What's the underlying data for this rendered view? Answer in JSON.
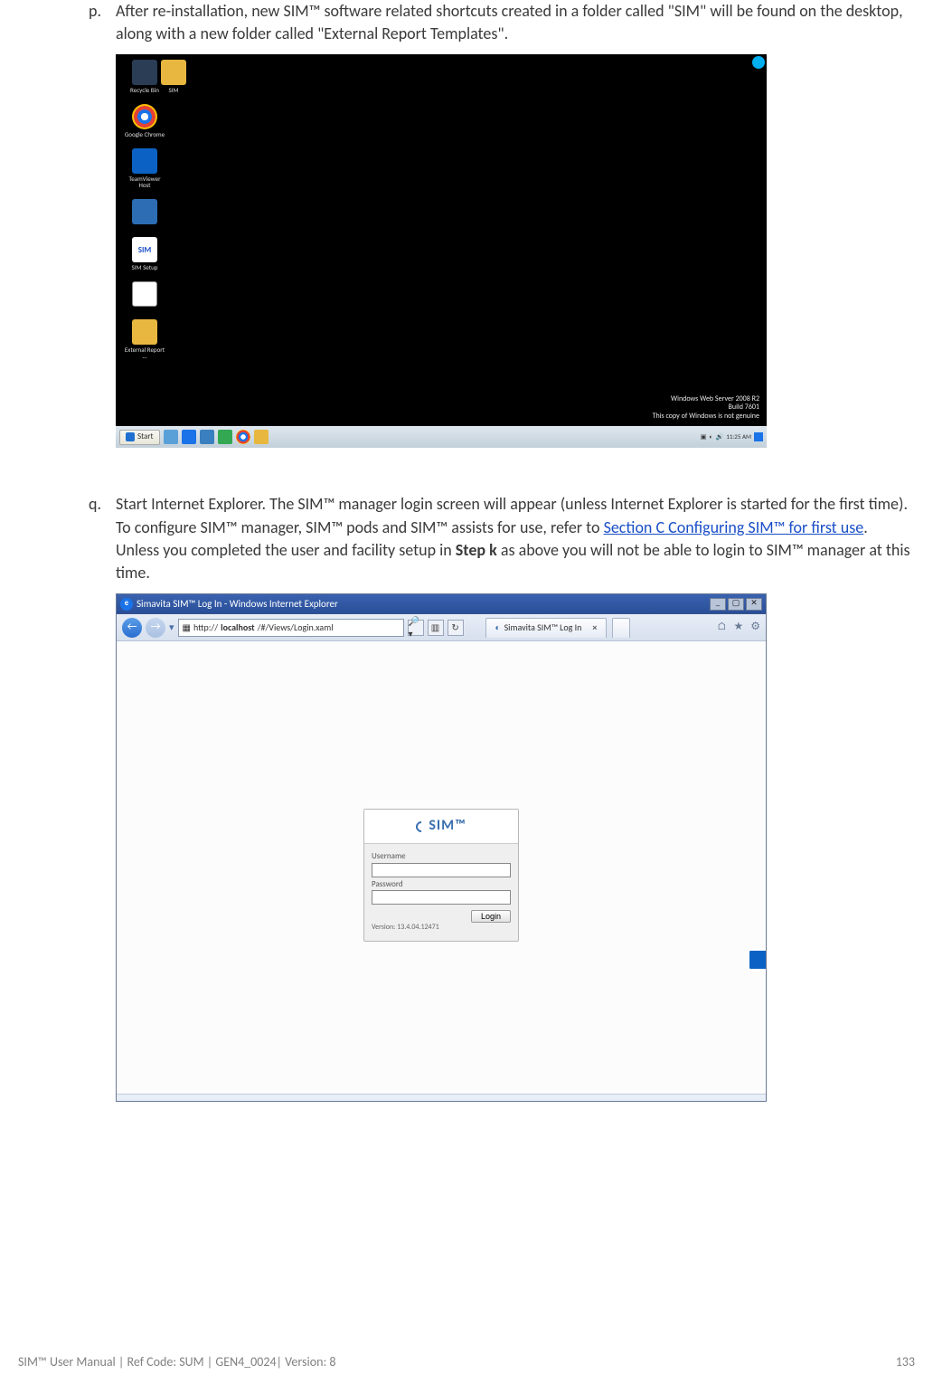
{
  "step_p": {
    "marker": "p.",
    "text": "After re-installation, new SIM™ software related shortcuts created in a folder called \"SIM\" will be found on the desktop, along with a new folder called \"External Report Templates\"."
  },
  "desktop": {
    "icons": [
      {
        "label": "Recycle Bin",
        "cls": "recycle"
      },
      {
        "label": "Google Chrome",
        "cls": "chrome"
      },
      {
        "label": "TeamViewer Host",
        "cls": "tv"
      },
      {
        "label": "",
        "cls": "pc"
      },
      {
        "label": "SIM Setup",
        "cls": "sim",
        "glyph": "SIM"
      },
      {
        "label": "",
        "cls": "doc"
      },
      {
        "label": "External Report ...",
        "cls": "folder2"
      }
    ],
    "icon2": {
      "label": "SIM",
      "cls": "folder"
    },
    "watermark_l1": "Windows Web Server 2008 R2",
    "watermark_l2": "Build 7601",
    "watermark_l3": "This copy of Windows is not genuine",
    "start": "Start",
    "clock": "11:25 AM"
  },
  "step_q": {
    "marker": "q.",
    "pre": "Start Internet Explorer. The SIM™ manager login screen will appear (unless Internet Explorer is started for the first time). To configure SIM™ manager, SIM™ pods and SIM™ assists for use, refer to ",
    "link": "Section C Configuring SIM™ for first use",
    "mid": ". Unless you completed the user and facility setup in ",
    "bold": "Step k",
    "post": " as above you will not be able to login to SIM™ manager at this time."
  },
  "ie": {
    "title": "Simavita SIM™ Log In - Windows Internet Explorer",
    "url_prefix": "http://",
    "url_host": "localhost",
    "url_path": "/#/Views/Login.xaml",
    "tab": "Simavita SIM™ Log In",
    "logo": "SIM™",
    "username_label": "Username",
    "password_label": "Password",
    "login_btn": "Login",
    "version": "Version: 13.4.04.12471"
  },
  "footer": {
    "left": "SIM™ User Manual | Ref Code: SUM | GEN4_0024| Version: 8",
    "right": "133"
  }
}
